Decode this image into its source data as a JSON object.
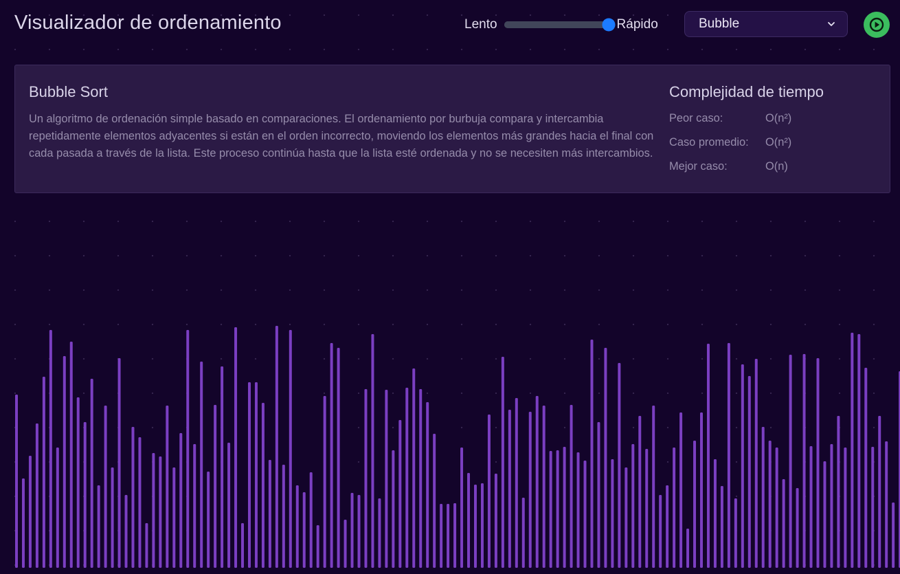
{
  "app": {
    "title": "Visualizador de ordenamiento"
  },
  "speed": {
    "slow_label": "Lento",
    "fast_label": "Rápido",
    "value_fraction": 1.0
  },
  "algorithm_select": {
    "value": "Bubble"
  },
  "play_button": {
    "icon": "play-icon",
    "color": "#3bbd5e"
  },
  "info": {
    "name": "Bubble Sort",
    "description": "Un algoritmo de ordenación simple basado en comparaciones. El ordenamiento por burbuja compara y intercambia repetidamente elementos adyacentes si están en el orden incorrecto, moviendo los elementos más grandes hacia el final con cada pasada a través de la lista. Este proceso continúa hasta que la lista esté ordenada y no se necesiten más intercambios.",
    "complexity": {
      "title": "Complejidad de tiempo",
      "rows": [
        {
          "label": "Peor caso:",
          "value": "O(n²)"
        },
        {
          "label": "Caso promedio:",
          "value": "O(n²)"
        },
        {
          "label": "Mejor caso:",
          "value": "O(n)"
        }
      ]
    }
  },
  "bars": {
    "color": "#7b3fc2",
    "values": [
      252,
      130,
      163,
      210,
      278,
      346,
      175,
      308,
      329,
      248,
      212,
      275,
      120,
      236,
      146,
      305,
      106,
      205,
      190,
      65,
      167,
      162,
      236,
      146,
      196,
      346,
      180,
      300,
      140,
      237,
      293,
      182,
      350,
      65,
      270,
      270,
      240,
      157,
      352,
      150,
      346,
      120,
      110,
      139,
      62,
      250,
      327,
      320,
      70,
      109,
      106,
      260,
      340,
      101,
      259,
      171,
      215,
      262,
      290,
      260,
      241,
      195,
      93,
      93,
      94,
      175,
      138,
      121,
      123,
      223,
      137,
      307,
      230,
      247,
      102,
      227,
      250,
      236,
      170,
      171,
      176,
      237,
      168,
      156,
      332,
      212,
      320,
      158,
      298,
      146,
      180,
      221,
      173,
      236,
      106,
      120,
      175,
      226,
      57,
      185,
      226,
      326,
      158,
      119,
      327,
      101,
      296,
      279,
      304,
      205,
      185,
      175,
      129,
      310,
      116,
      311,
      177,
      305,
      155,
      180,
      221,
      175,
      342,
      340,
      291,
      176,
      221,
      184,
      95,
      286
    ]
  }
}
